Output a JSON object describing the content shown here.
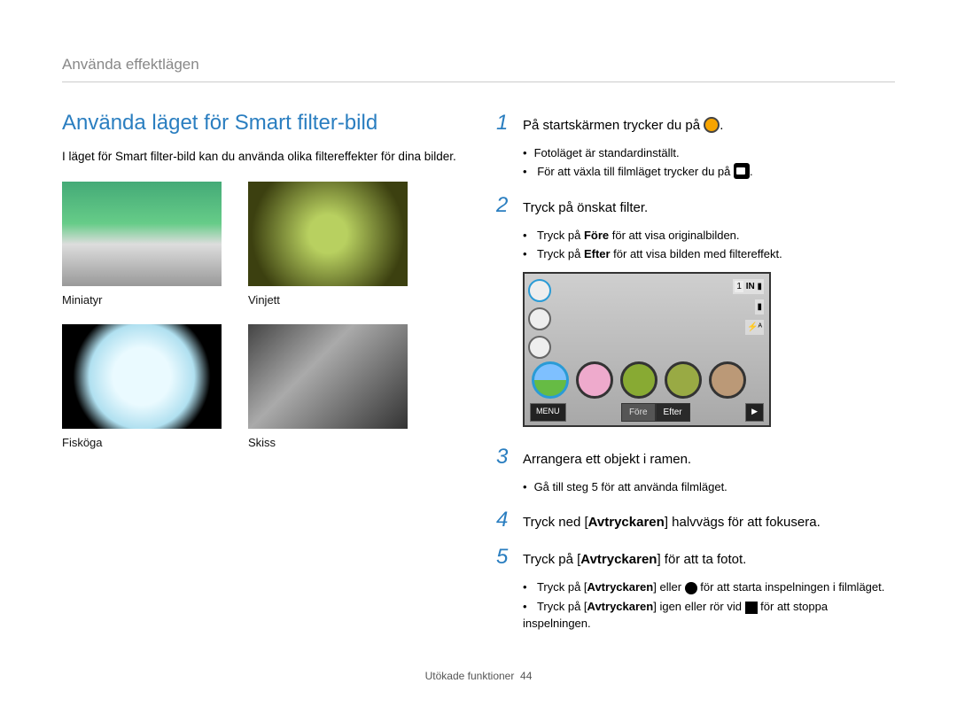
{
  "breadcrumb": "Använda effektlägen",
  "left": {
    "heading": "Använda läget för Smart filter-bild",
    "intro": "I läget för Smart filter-bild kan du använda olika filtereffekter för dina bilder.",
    "thumbs": [
      {
        "label": "Miniatyr"
      },
      {
        "label": "Vinjett"
      },
      {
        "label": "Fisköga"
      },
      {
        "label": "Skiss"
      }
    ]
  },
  "right": {
    "step1": {
      "num": "1",
      "text": "På startskärmen trycker du på "
    },
    "step1_subs": [
      "Fotoläget är standardinställt.",
      "För att växla till filmläget trycker du på "
    ],
    "step2": {
      "num": "2",
      "text": "Tryck på önskat filter."
    },
    "step2_subs_a": "Tryck på ",
    "step2_subs_a_bold": "Före",
    "step2_subs_a_tail": " för att visa originalbilden.",
    "step2_subs_b": "Tryck på ",
    "step2_subs_b_bold": "Efter",
    "step2_subs_b_tail": " för att visa bilden med filtereffekt.",
    "camera": {
      "menu": "MENU",
      "before": "Före",
      "after": "Efter",
      "count": "1",
      "in": "IN"
    },
    "step3": {
      "num": "3",
      "text": "Arrangera ett objekt i ramen."
    },
    "step3_subs": [
      "Gå till steg 5 för att använda filmläget."
    ],
    "step4": {
      "num": "4",
      "pre": "Tryck ned [",
      "bold": "Avtryckaren",
      "post": "] halvvägs för att fokusera."
    },
    "step5": {
      "num": "5",
      "pre": "Tryck på [",
      "bold": "Avtryckaren",
      "post": "] för att ta fotot."
    },
    "step5_sub_a_pre": "Tryck på [",
    "step5_sub_a_bold": "Avtryckaren",
    "step5_sub_a_mid": "] eller ",
    "step5_sub_a_post": " för att starta inspelningen i filmläget.",
    "step5_sub_b_pre": "Tryck på [",
    "step5_sub_b_bold": "Avtryckaren",
    "step5_sub_b_mid": "] igen eller rör vid ",
    "step5_sub_b_post": " för att stoppa inspelningen."
  },
  "footer": {
    "section": "Utökade funktioner",
    "page": "44"
  }
}
